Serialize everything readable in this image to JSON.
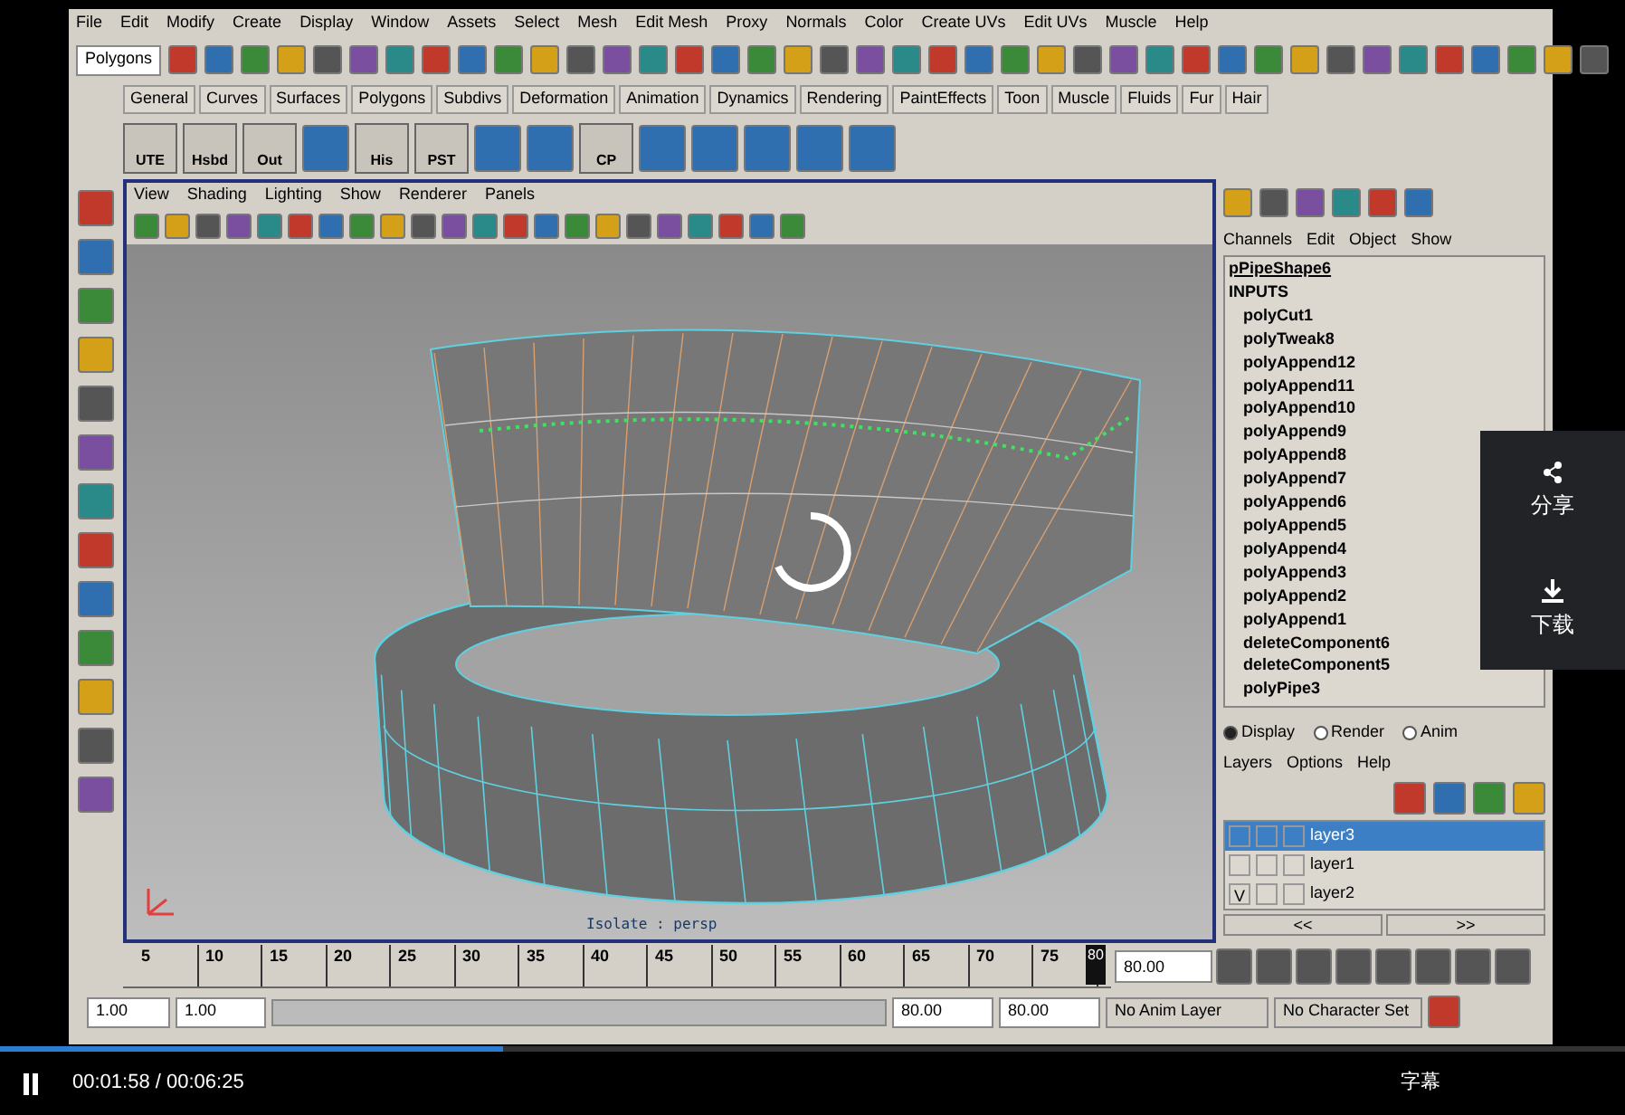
{
  "menu_bar": [
    "File",
    "Edit",
    "Modify",
    "Create",
    "Display",
    "Window",
    "Assets",
    "Select",
    "Mesh",
    "Edit Mesh",
    "Proxy",
    "Normals",
    "Color",
    "Create UVs",
    "Edit UVs",
    "Muscle",
    "Help"
  ],
  "status_line": {
    "mode": "Polygons"
  },
  "shelf_tabs": [
    "General",
    "Curves",
    "Surfaces",
    "Polygons",
    "Subdivs",
    "Deformation",
    "Animation",
    "Dynamics",
    "Rendering",
    "PaintEffects",
    "Toon",
    "Muscle",
    "Fluids",
    "Fur",
    "Hair"
  ],
  "shelf_buttons": [
    "UTE",
    "Hsbd",
    "Out",
    "His",
    "PST",
    "CP"
  ],
  "viewport": {
    "menu": [
      "View",
      "Shading",
      "Lighting",
      "Show",
      "Renderer",
      "Panels"
    ],
    "camera_label": "Isolate : persp"
  },
  "channel_box": {
    "menu": [
      "Channels",
      "Edit",
      "Object",
      "Show"
    ],
    "object": "pPipeShape6",
    "section": "INPUTS",
    "inputs": [
      "polyCut1",
      "polyTweak8",
      "polyAppend12",
      "polyAppend11",
      "polyAppend10",
      "polyAppend9",
      "polyAppend8",
      "polyAppend7",
      "polyAppend6",
      "polyAppend5",
      "polyAppend4",
      "polyAppend3",
      "polyAppend2",
      "polyAppend1",
      "deleteComponent6",
      "deleteComponent5",
      "polyPipe3"
    ]
  },
  "layer_editor": {
    "modes": [
      {
        "label": "Display",
        "selected": true
      },
      {
        "label": "Render",
        "selected": false
      },
      {
        "label": "Anim",
        "selected": false
      }
    ],
    "menu": [
      "Layers",
      "Options",
      "Help"
    ],
    "layers": [
      {
        "name": "layer3",
        "selected": true
      },
      {
        "name": "layer1",
        "selected": false
      },
      {
        "name": "layer2",
        "selected": false,
        "visibility": "V"
      }
    ],
    "nav": [
      "<<",
      ">>"
    ]
  },
  "time_slider": {
    "ticks": [
      "5",
      "10",
      "15",
      "20",
      "25",
      "30",
      "35",
      "40",
      "45",
      "50",
      "55",
      "60",
      "65",
      "70",
      "75"
    ],
    "marker": "80",
    "level": 1,
    "current_frame": "80.00"
  },
  "range_slider": {
    "start": "1.00",
    "playback_start": "1.00",
    "playback_end": "80.00",
    "end": "80.00",
    "level": 1,
    "anim_layer": "No Anim Layer",
    "character_set": "No Character Set"
  },
  "player": {
    "level": 0.31,
    "time": "00:01:58 / 00:06:25",
    "subtitles": "字幕"
  },
  "side_panel": [
    {
      "kind": "share",
      "label": "分享"
    },
    {
      "kind": "download",
      "label": "下载"
    }
  ]
}
